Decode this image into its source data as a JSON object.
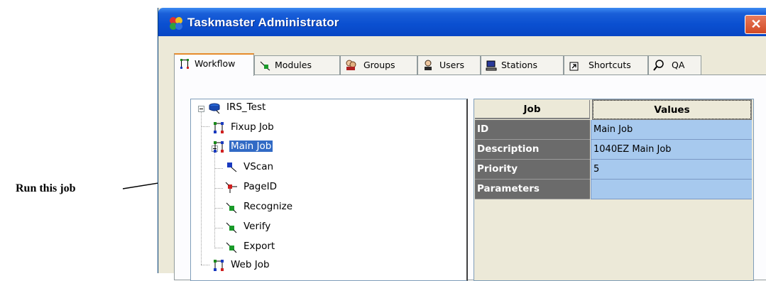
{
  "callout": {
    "text": "Run this job"
  },
  "window": {
    "title": "Taskmaster Administrator",
    "close_glyph": "✕"
  },
  "tabs": [
    {
      "label": "Workflow",
      "icon": "workflow-icon",
      "active": true
    },
    {
      "label": "Modules",
      "icon": "modules-icon"
    },
    {
      "label": "Groups",
      "icon": "groups-icon"
    },
    {
      "label": "Users",
      "icon": "users-icon"
    },
    {
      "label": "Stations",
      "icon": "stations-icon"
    },
    {
      "label": "Shortcuts",
      "icon": "shortcut-icon"
    },
    {
      "label": "QA",
      "icon": "magnifier-icon"
    }
  ],
  "tree": {
    "root": "IRS_Test",
    "items": [
      {
        "label": "Fixup Job",
        "icon": "job-icon"
      },
      {
        "label": "Main Job",
        "icon": "job-icon",
        "selected": true
      },
      {
        "label": "VScan",
        "icon": "vscan-module-icon"
      },
      {
        "label": "PageID",
        "icon": "pageid-module-icon"
      },
      {
        "label": "Recognize",
        "icon": "recognize-module-icon"
      },
      {
        "label": "Verify",
        "icon": "verify-module-icon"
      },
      {
        "label": "Export",
        "icon": "export-module-icon"
      },
      {
        "label": "Web Job",
        "icon": "job-icon"
      }
    ]
  },
  "grid": {
    "headers": {
      "key": "Job",
      "value": "Values"
    },
    "rows": [
      {
        "key": "ID",
        "value": "Main Job"
      },
      {
        "key": "Description",
        "value": "1040EZ Main Job"
      },
      {
        "key": "Priority",
        "value": "5"
      },
      {
        "key": "Parameters",
        "value": ""
      }
    ]
  },
  "colors": {
    "titlebar": "#0a4fd0",
    "selection": "#316ac5",
    "value_cell": "#a7c9ee",
    "key_cell": "#6b6b6b",
    "tab_highlight": "#e68b2c"
  }
}
